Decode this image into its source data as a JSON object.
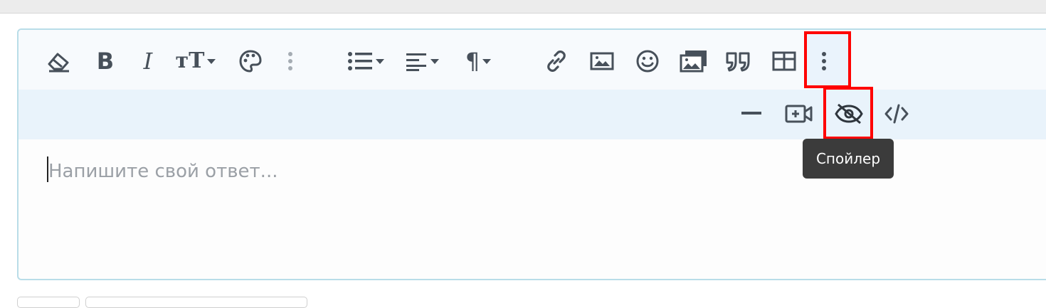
{
  "window": {
    "title": ""
  },
  "editor": {
    "placeholder": "Напишите свой ответ...",
    "toolbar": {
      "bold_label": "B",
      "italic_label": "I",
      "font_size_label": "тT",
      "paragraph_label": "¶",
      "icons": [
        "eraser-icon",
        "bold-icon",
        "italic-icon",
        "font-size-icon",
        "palette-icon",
        "vertical-dots-icon",
        "list-icon",
        "align-icon",
        "paragraph-icon",
        "link-icon",
        "image-icon",
        "smiley-icon",
        "media-gallery-icon",
        "quote-icon",
        "table-icon",
        "more-options-icon"
      ]
    },
    "more_toolbar": {
      "icons": [
        "horizontal-rule-icon",
        "add-video-icon",
        "spoiler-eye-slash-icon",
        "code-icon"
      ]
    }
  },
  "tooltip": {
    "text": "Спойлер"
  },
  "colors": {
    "icon": "#47505a",
    "highlight": "#ff0000",
    "toolbar_bg": "#f7fafd",
    "more_bg": "#e9f3fb",
    "editor_border": "#b9dde8",
    "tooltip_bg": "#3b3b3b"
  }
}
